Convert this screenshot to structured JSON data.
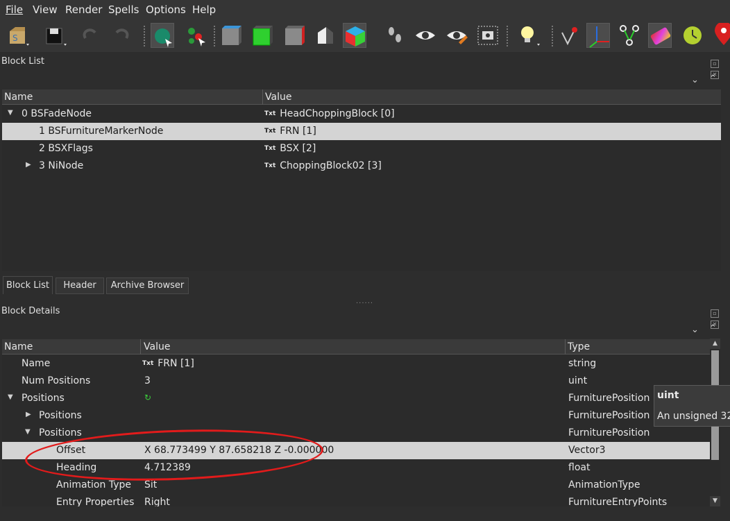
{
  "menu": [
    "File",
    "View",
    "Render",
    "Spells",
    "Options",
    "Help"
  ],
  "toolbar_icons": [
    "load-icon",
    "save-icon",
    "undo-icon",
    "redo-icon",
    "select-object-icon",
    "select-vertex-icon",
    "cube-gray-icon",
    "cube-green-icon",
    "cube-red-icon",
    "shape-toggle-icon",
    "cube-colored-icon",
    "footprints-icon",
    "eye-icon",
    "eye-edit-icon",
    "screenshot-icon",
    "lightbulb-icon",
    "marker-vector-icon",
    "axes-icon",
    "nodes-icon",
    "gradient-icon",
    "clock-icon",
    "pin-icon"
  ],
  "block_list": {
    "title": "Block List",
    "columns": [
      "Name",
      "Value"
    ],
    "rows": [
      {
        "name": "0 BSFadeNode",
        "value": "HeadChoppingBlock [0]",
        "expanded": true,
        "depth": 0
      },
      {
        "name": "1 BSFurnitureMarkerNode",
        "value": "FRN [1]",
        "selected": true,
        "depth": 1
      },
      {
        "name": "2 BSXFlags",
        "value": "BSX [2]",
        "depth": 1
      },
      {
        "name": "3 NiNode",
        "value": "ChoppingBlock02 [3]",
        "collapsed": true,
        "depth": 1
      }
    ],
    "txt_badge": "Txt"
  },
  "tabs": [
    "Block List",
    "Header",
    "Archive Browser"
  ],
  "block_details": {
    "title": "Block Details",
    "columns": [
      "Name",
      "Value",
      "Type"
    ],
    "rows": [
      {
        "name": "Name",
        "value": "FRN [1]",
        "type": "string",
        "badge": true
      },
      {
        "name": "Num Positions",
        "value": "3",
        "type": "uint"
      },
      {
        "name": "Positions",
        "value": "",
        "type": "FurniturePosition",
        "expanded": true,
        "refresh": true
      },
      {
        "name": "Positions",
        "value": "",
        "type": "FurniturePosition",
        "collapsed": true
      },
      {
        "name": "Positions",
        "value": "",
        "type": "FurniturePosition",
        "expanded": true
      },
      {
        "name": "Offset",
        "value": "X 68.773499 Y 87.658218 Z -0.000000",
        "type": "Vector3",
        "selected": true
      },
      {
        "name": "Heading",
        "value": "4.712389",
        "type": "float"
      },
      {
        "name": "Animation Type",
        "value": "Sit",
        "type": "AnimationType"
      },
      {
        "name": "Entry Properties",
        "value": "Right",
        "type": "FurnitureEntryPoints"
      }
    ]
  },
  "tooltip": {
    "title": "uint",
    "description": "An unsigned 32-"
  },
  "colors": {
    "background": "#2d2d2d",
    "selected_row": "#d4d4d4",
    "highlight": "#e21b1b"
  }
}
